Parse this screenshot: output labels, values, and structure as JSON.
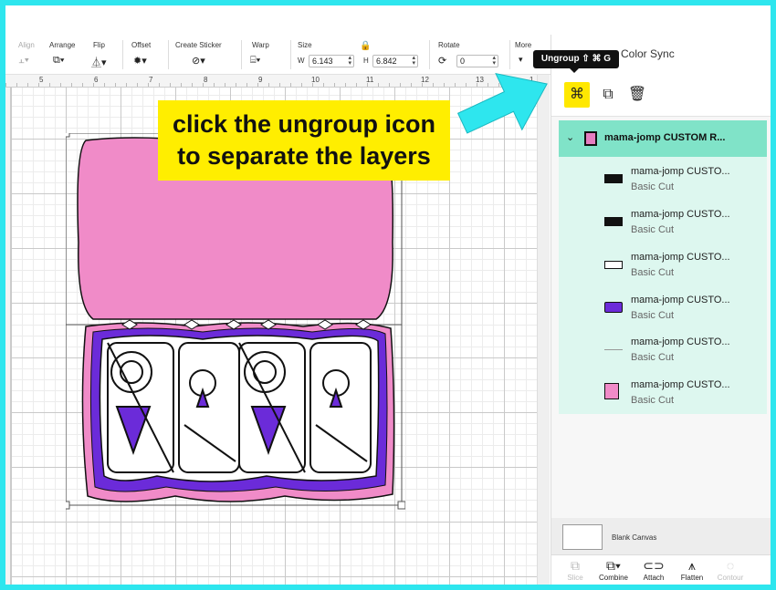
{
  "toolbar": {
    "align": "Align",
    "arrange": "Arrange",
    "flip": "Flip",
    "offset": "Offset",
    "create_sticker": "Create Sticker",
    "warp": "Warp",
    "size": "Size",
    "w_label": "W",
    "w_value": "6.143",
    "h_label": "H",
    "h_value": "6.842",
    "rotate": "Rotate",
    "rotate_value": "0",
    "more": "More"
  },
  "ruler": {
    "numbers": [
      "5",
      "6",
      "7",
      "8",
      "9",
      "10",
      "11",
      "12",
      "13",
      "1"
    ]
  },
  "panel": {
    "tab_color_sync": "Color Sync",
    "tooltip": "Ungroup ⇧ ⌘ G",
    "group": {
      "name": "mama-jomp CUSTOM R..."
    },
    "layers": [
      {
        "name": "mama-jomp CUSTO...",
        "operation": "Basic Cut"
      },
      {
        "name": "mama-jomp CUSTO...",
        "operation": "Basic Cut"
      },
      {
        "name": "mama-jomp CUSTO...",
        "operation": "Basic Cut"
      },
      {
        "name": "mama-jomp CUSTO...",
        "operation": "Basic Cut"
      },
      {
        "name": "mama-jomp CUSTO...",
        "operation": "Basic Cut"
      },
      {
        "name": "mama-jomp CUSTO...",
        "operation": "Basic Cut"
      }
    ],
    "blank_canvas": "Blank Canvas",
    "bottom": {
      "slice": "Slice",
      "combine": "Combine",
      "attach": "Attach",
      "flatten": "Flatten",
      "contour": "Contour"
    }
  },
  "annotation": {
    "line1": "click the ungroup icon",
    "line2": "to separate the layers"
  },
  "colors": {
    "border": "#2ee6ee",
    "highlight": "#ffee00",
    "group_row": "#80e3c8",
    "layers_bg": "#ddf7ef",
    "pink": "#f08bc8",
    "purple": "#6b2bd9",
    "arrow": "#2ee6ee"
  },
  "icons": [
    "ungroup-icon",
    "duplicate-icon",
    "trash-icon",
    "chevron-down-icon",
    "lock-icon"
  ]
}
